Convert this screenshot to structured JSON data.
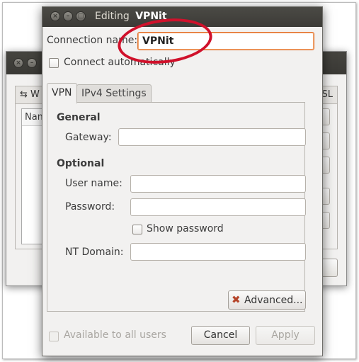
{
  "dialog": {
    "title_prefix": "Editing",
    "title_name": "VPNit",
    "connection_name_label": "Connection name:",
    "connection_name_value": "VPNit",
    "connect_automatically_label": "Connect automatically",
    "tabs": [
      {
        "label": "VPN",
        "active": true
      },
      {
        "label": "IPv4 Settings",
        "active": false
      }
    ],
    "vpn": {
      "general_heading": "General",
      "gateway_label": "Gateway:",
      "gateway_value": "",
      "optional_heading": "Optional",
      "username_label": "User name:",
      "username_value": "",
      "password_label": "Password:",
      "password_value": "",
      "show_password_label": "Show password",
      "nt_domain_label": "NT Domain:",
      "nt_domain_value": "",
      "advanced_button": "Advanced..."
    },
    "available_to_all_users_label": "Available to all users",
    "cancel_button": "Cancel",
    "apply_button": "Apply"
  },
  "background_window": {
    "tab_partial_left": "W",
    "tab_partial_right": "SL",
    "list_header": "Nam"
  },
  "colors": {
    "titlebar": "#3c3b37",
    "focus_outline": "#e3722f",
    "annotation_oval": "#d0112b"
  }
}
